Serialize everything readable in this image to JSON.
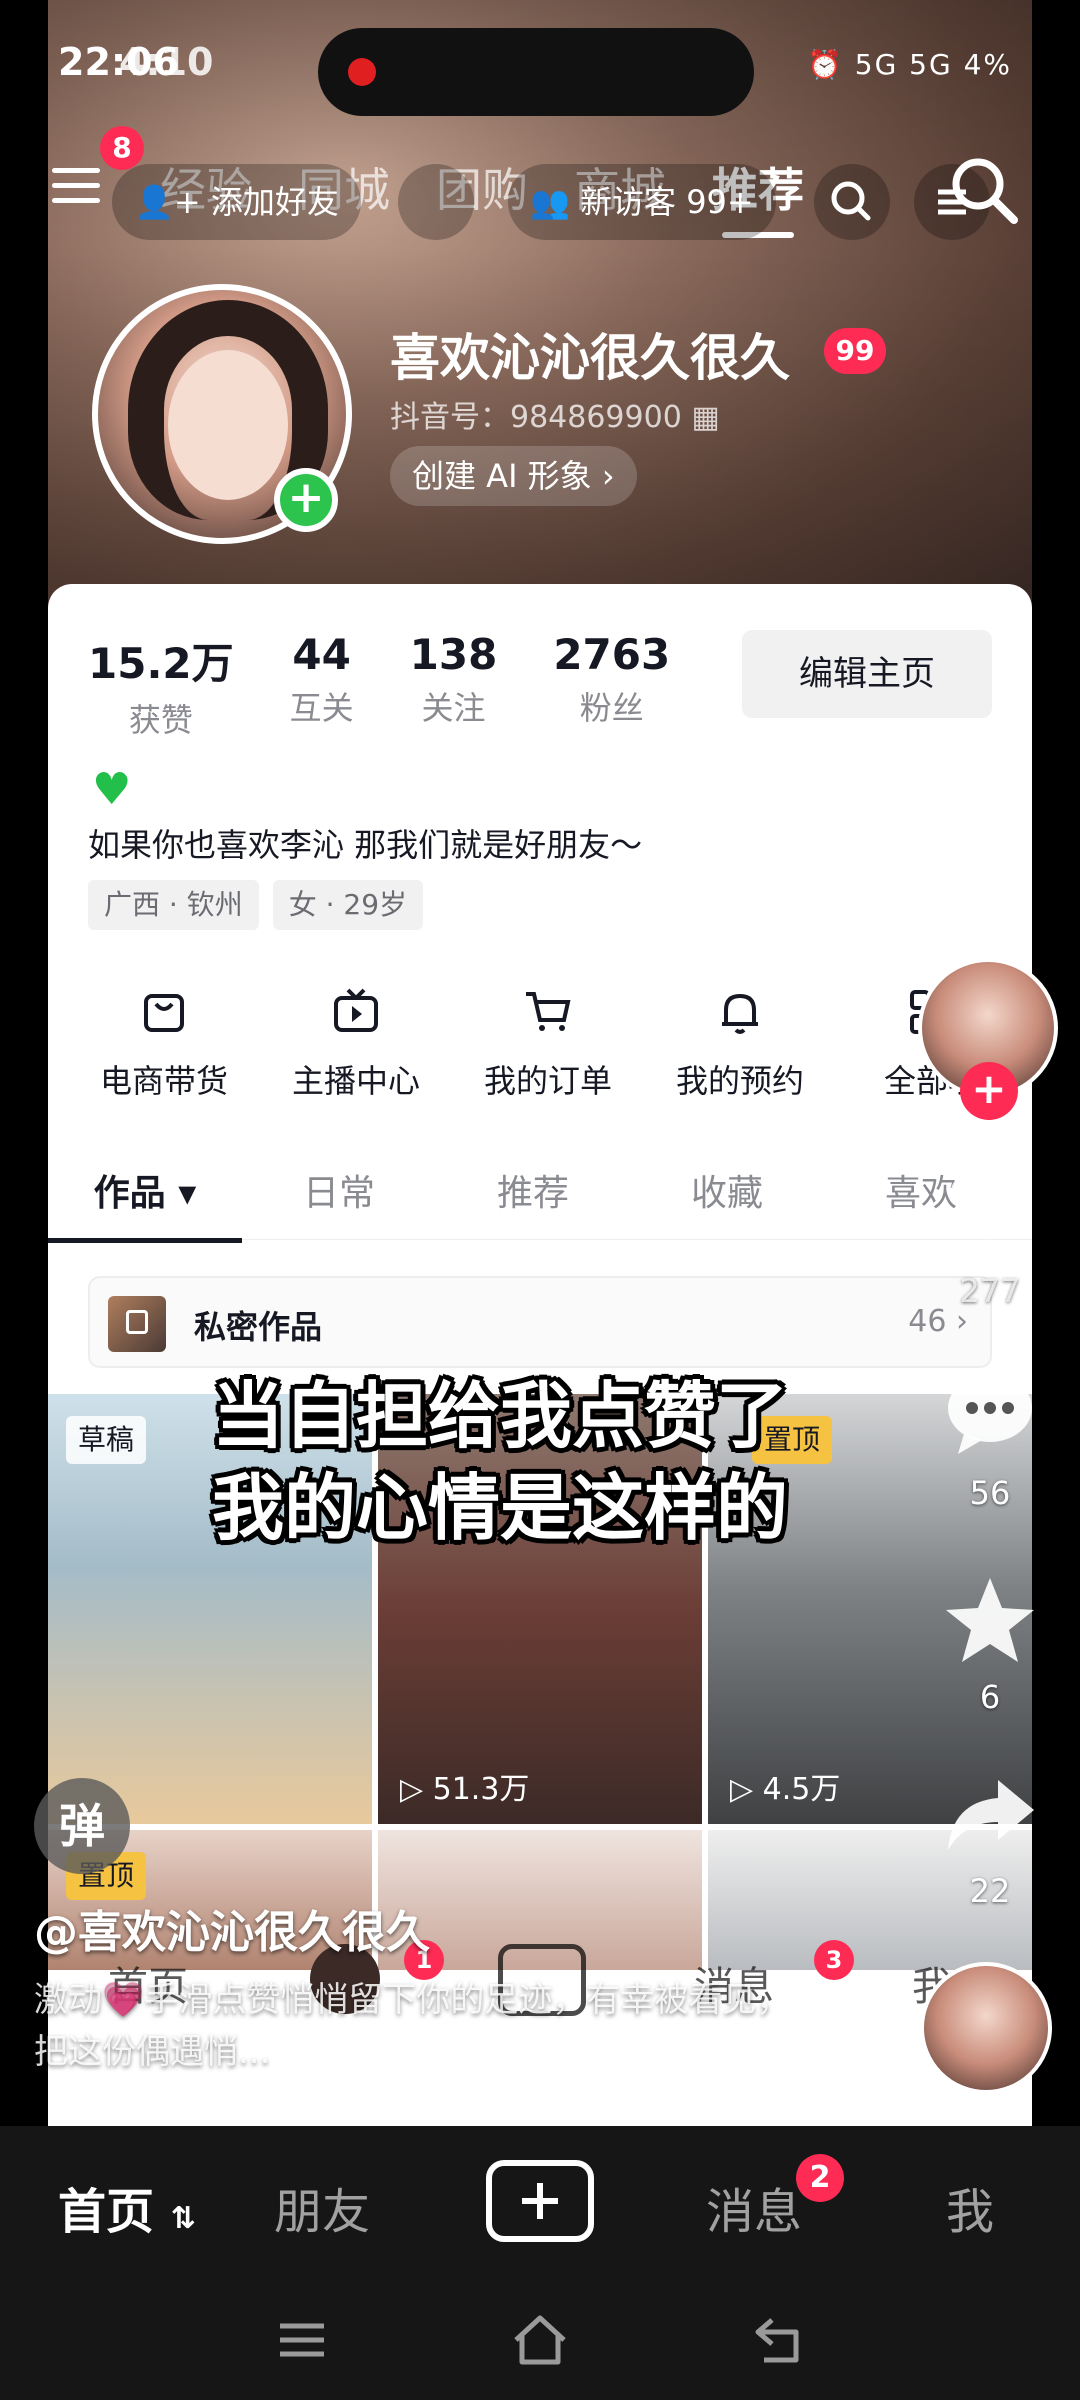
{
  "status": {
    "time": "22:06",
    "time_overlay": "4:10",
    "icons_text": "⏰ 5G 5G 4%"
  },
  "topnav": {
    "menu_badge": "8",
    "tabs": [
      "经验",
      "同城",
      "团购",
      "商城",
      "推荐"
    ],
    "add_friend": "添加好友",
    "new_visitors": "新访客 99+"
  },
  "profile": {
    "nickname": "喜欢沁沁很久很久",
    "level": "99",
    "douyin_id": "抖音号：984869900",
    "ai_button": "创建 AI 形象"
  },
  "stats": [
    {
      "value": "15.2万",
      "label": "获赞"
    },
    {
      "value": "44",
      "label": "互关"
    },
    {
      "value": "138",
      "label": "关注"
    },
    {
      "value": "2763",
      "label": "粉丝"
    }
  ],
  "edit_button": "编辑主页",
  "bio": "如果你也喜欢李沁 那我们就是好朋友～",
  "tags": [
    "广西 · 钦州",
    "女 · 29岁"
  ],
  "tools": [
    "电商带货",
    "主播中心",
    "我的订单",
    "我的预约",
    "全部功"
  ],
  "content_tabs": [
    "作品",
    "日常",
    "推荐",
    "收藏",
    "喜欢"
  ],
  "private": {
    "title": "私密作品",
    "count": "46"
  },
  "grid": {
    "cells": [
      {
        "tag": "草稿",
        "plays": ""
      },
      {
        "tag": "",
        "plays": "51.3万"
      },
      {
        "tag": "置顶",
        "plays": "4.5万"
      },
      {
        "tag": "置顶",
        "plays": ""
      },
      {
        "tag": "",
        "plays": ""
      },
      {
        "tag": "",
        "plays": ""
      }
    ]
  },
  "caption": [
    "当自担给我点赞了",
    "我的心情是这样的"
  ],
  "rail": {
    "likes": "277",
    "comments": "56",
    "favorites": "6",
    "shares": "22"
  },
  "danmu": "弹",
  "author": "@喜欢沁沁很久很久",
  "description": "激动💗手滑点赞悄悄留下你的足迹，有幸被看见，把这份偶遇悄...",
  "inner_nav": {
    "home": "首页",
    "messages": "消息",
    "messages_badge": "3",
    "me": "我",
    "friends_badge": "1"
  },
  "tabbar": {
    "home": "首页",
    "friends": "朋友",
    "messages": "消息",
    "messages_badge": "2",
    "me": "我"
  }
}
